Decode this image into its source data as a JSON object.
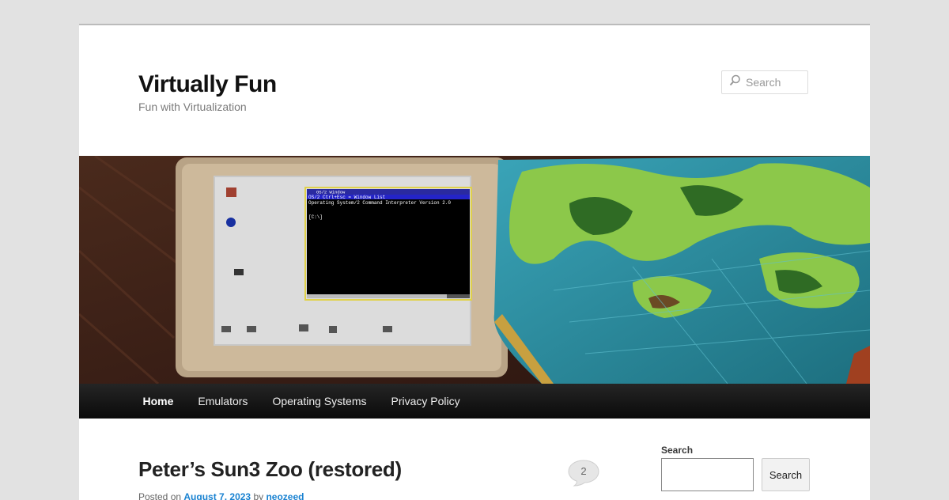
{
  "site": {
    "title": "Virtually Fun",
    "description": "Fun with Virtualization"
  },
  "header_search": {
    "placeholder": "Search",
    "icon": "search-icon"
  },
  "header_image": {
    "terminal_lines": [
      "OS/2 Window",
      "OS/2        Ctrl+Esc = Window List",
      "Operating System/2 Command Interpreter Version 2.0",
      "[C:\\]"
    ]
  },
  "nav": {
    "items": [
      {
        "label": "Home",
        "active": true
      },
      {
        "label": "Emulators",
        "active": false
      },
      {
        "label": "Operating Systems",
        "active": false
      },
      {
        "label": "Privacy Policy",
        "active": false
      }
    ]
  },
  "post": {
    "title": "Peter’s Sun3 Zoo (restored)",
    "posted_on": "Posted on",
    "date": "August 7, 2023",
    "by": "by",
    "author": "neozeed",
    "comment_count": "2"
  },
  "sidebar": {
    "search_label": "Search",
    "search_button": "Search"
  },
  "colors": {
    "link": "#1982d1",
    "nav_bg": "#111111",
    "page_bg": "#e2e2e2"
  }
}
